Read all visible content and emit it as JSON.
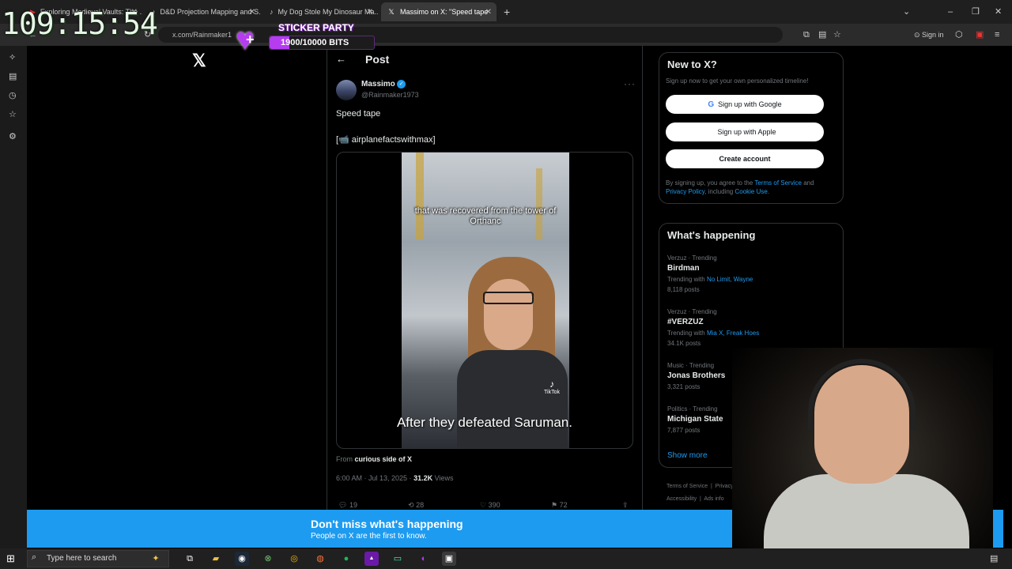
{
  "browser": {
    "tabs": [
      {
        "label": "Exploring Medieval Vaults: The ...",
        "active": false
      },
      {
        "label": "D&D Projection Mapping and S...",
        "active": false
      },
      {
        "label": "My Dog Stole My Dinosaur Ma...",
        "active": false
      },
      {
        "label": "Massimo on X: \"Speed tape",
        "active": true
      }
    ],
    "url": "x.com/Rainmaker1",
    "sign_in": "Sign in"
  },
  "overlay": {
    "clock": "109:15:54",
    "sticker_title": "STICKER PARTY",
    "sticker_bits": "1900/10000 BITS",
    "sticker_progress": 0.19
  },
  "page": {
    "post_title": "Post",
    "author": {
      "name": "Massimo",
      "handle": "@Rainmaker1973"
    },
    "text": "Speed tape",
    "credit": "[📹 airplanefactswithmax]",
    "video_caption_top": "that was recovered from the tower of Orthanc",
    "tiktok": "TikTok",
    "subtitle": "After they defeated Saruman.",
    "source_prefix": "From",
    "source_name": "curious side of X",
    "timestamp": "6:00 AM · Jul 13, 2025 ·",
    "views_count": "31.2K",
    "views_label": "Views",
    "actions": {
      "replies": "19",
      "reposts": "28",
      "likes": "390",
      "bookmarks": "72"
    }
  },
  "sidebar": {
    "new_title": "New to X?",
    "new_sub": "Sign up now to get your own personalized timeline!",
    "google": "Sign up with Google",
    "apple": "Sign up with Apple",
    "create": "Create account",
    "terms_1": "By signing up, you agree to the",
    "terms_link1": "Terms of Service",
    "terms_2": "and",
    "terms_link2": "Privacy Policy",
    "terms_3": ", including",
    "terms_link3": "Cookie Use.",
    "happening_title": "What's happening",
    "trends": [
      {
        "context": "Verzuz · Trending",
        "name": "Birdman",
        "with_label": "Trending with",
        "with": "No Limit, Wayne",
        "posts": "8,118 posts"
      },
      {
        "context": "Verzuz · Trending",
        "name": "#VERZUZ",
        "with_label": "Trending with",
        "with": "Mia X, Freak Hoes",
        "posts": "34.1K posts"
      },
      {
        "context": "Music · Trending",
        "name": "Jonas Brothers",
        "posts": "3,321 posts"
      },
      {
        "context": "Politics · Trending",
        "name": "Michigan State",
        "posts": "7,877 posts"
      }
    ],
    "show_more": "Show more",
    "footer_1": "Terms of Service",
    "footer_2": "Privacy Po",
    "footer_3": "Accessibility",
    "footer_4": "Ads info"
  },
  "banner": {
    "title": "Don't miss what's happening",
    "subtitle": "People on X are the first to know."
  },
  "taskbar": {
    "search_placeholder": "Type here to search"
  },
  "colors": {
    "accent": "#1d9bf0",
    "sticker_purple": "#b63cf0"
  }
}
